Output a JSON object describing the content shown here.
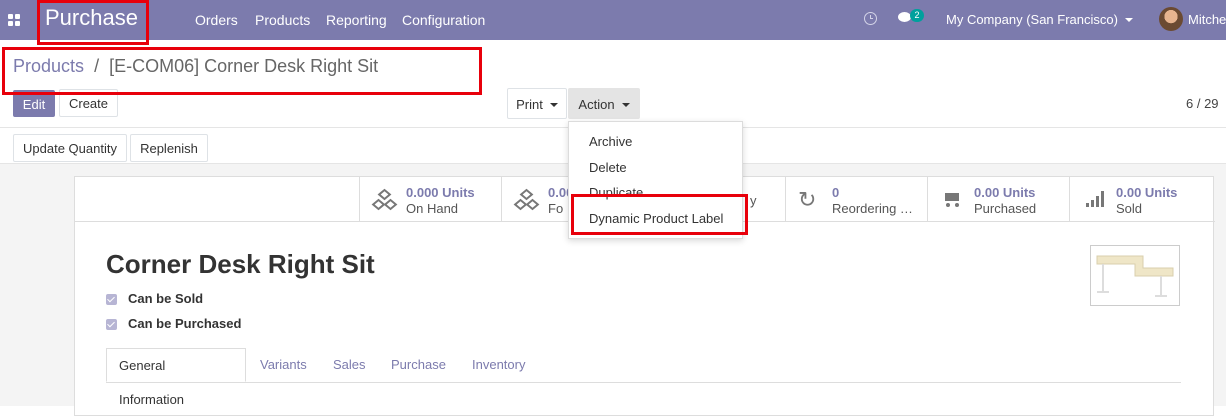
{
  "navbar": {
    "app_title": "Purchase",
    "menu": [
      "Orders",
      "Products",
      "Reporting",
      "Configuration"
    ],
    "chat_count": "2",
    "company": "My Company (San Francisco)",
    "user": "Mitche"
  },
  "breadcrumb": {
    "parent": "Products",
    "separator": "/",
    "current": "[E-COM06] Corner Desk Right Sit"
  },
  "buttons": {
    "edit": "Edit",
    "create": "Create",
    "print": "Print",
    "action": "Action",
    "update_quantity": "Update Quantity",
    "replenish": "Replenish"
  },
  "pager": "6 / 29",
  "action_menu": [
    "Archive",
    "Delete",
    "Duplicate",
    "Dynamic Product Label"
  ],
  "smart_buttons": [
    {
      "value": "0.000 Units",
      "label": "On Hand",
      "icon": "cubes-icon"
    },
    {
      "value": "0.00",
      "label": "Fo",
      "icon": "cubes-icon"
    },
    {
      "value": "",
      "label": "y",
      "icon": ""
    },
    {
      "value": "0",
      "label": "Reordering …",
      "icon": "refresh-icon"
    },
    {
      "value": "0.00 Units",
      "label": "Purchased",
      "icon": "cart-icon"
    },
    {
      "value": "0.00 Units",
      "label": "Sold",
      "icon": "signal-icon"
    }
  ],
  "product": {
    "name": "Corner Desk Right Sit",
    "can_be_sold": "Can be Sold",
    "can_be_purchased": "Can be Purchased"
  },
  "tabs": [
    "General Information",
    "Variants",
    "Sales",
    "Purchase",
    "Inventory"
  ],
  "colors": {
    "brand": "#7c7bad",
    "highlight": "#e8000b",
    "badge": "#00a09d"
  }
}
